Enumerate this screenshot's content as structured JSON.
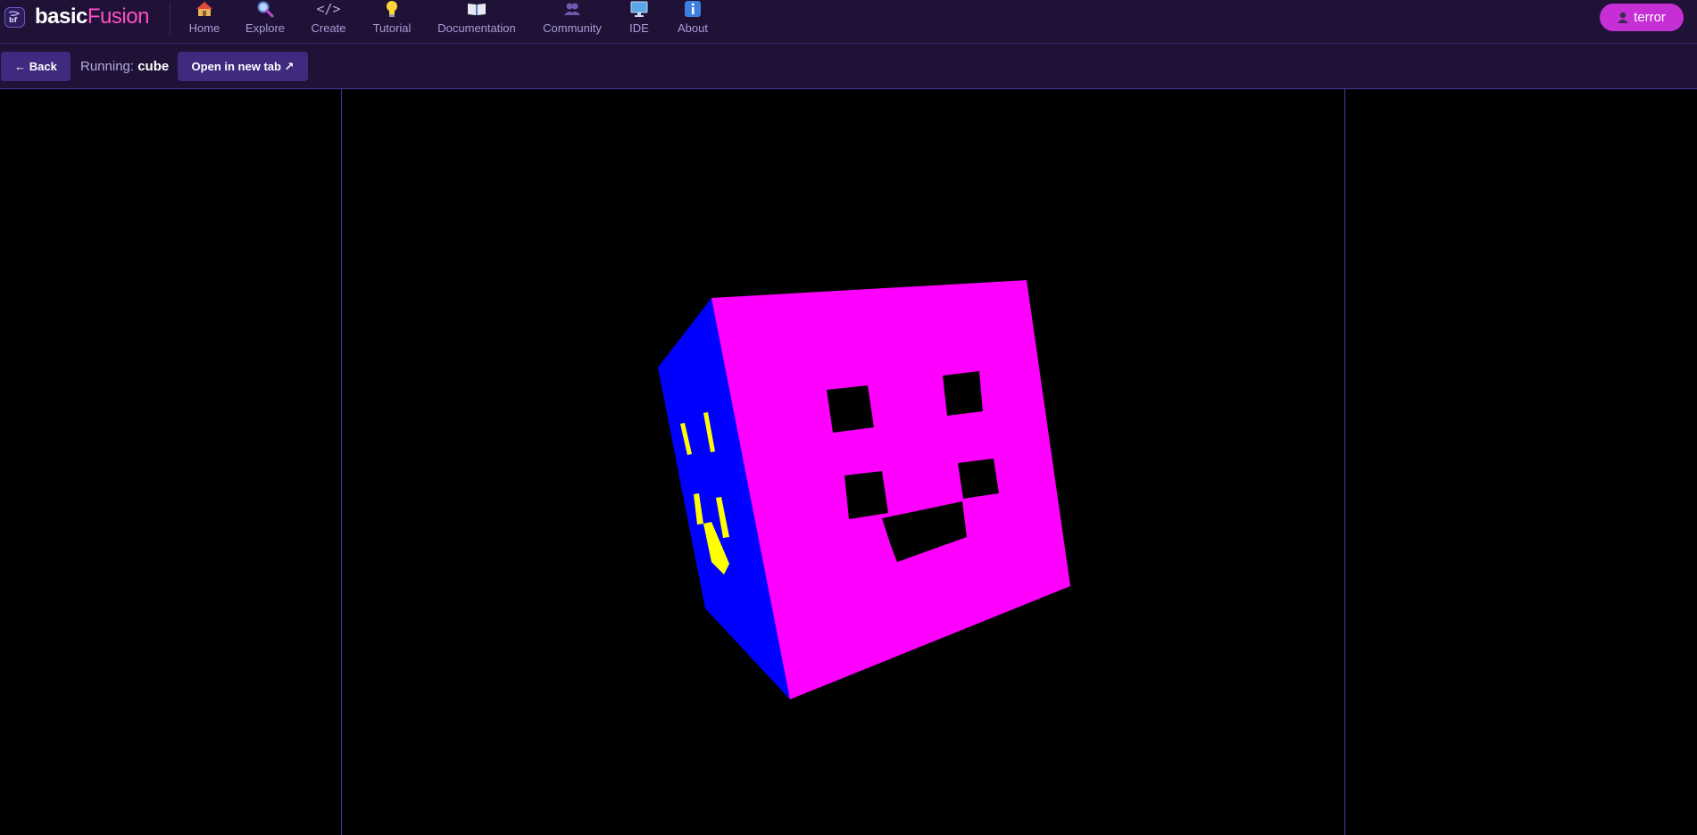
{
  "brand": {
    "part1": "basic",
    "part2": "Fusion",
    "logo_icon": "bf-logo-icon"
  },
  "nav": [
    {
      "label": "Home",
      "icon": "house-icon",
      "active": false
    },
    {
      "label": "Explore",
      "icon": "magnifier-icon",
      "active": true
    },
    {
      "label": "Create",
      "icon": "code-icon",
      "active": false
    },
    {
      "label": "Tutorial",
      "icon": "lightbulb-icon",
      "active": false
    },
    {
      "label": "Documentation",
      "icon": "book-icon",
      "active": false
    },
    {
      "label": "Community",
      "icon": "people-icon",
      "active": false
    },
    {
      "label": "IDE",
      "icon": "monitor-icon",
      "active": false
    },
    {
      "label": "About",
      "icon": "info-icon",
      "active": false
    }
  ],
  "user": {
    "name": "terror",
    "icon": "user-icon"
  },
  "toolbar": {
    "back_label": "← Back",
    "running_prefix": "Running:",
    "program_name": "cube",
    "open_new_tab_label": "Open in new tab ↗"
  },
  "colors": {
    "nav_bg": "#1f1236",
    "accent": "#c62fd6",
    "button_bg": "#3f2a7f",
    "cube_front": "#ff00ff",
    "cube_side": "#0000ff",
    "cube_side_marks": "#ffff00",
    "brand_fusion": "#ff4fc6"
  }
}
